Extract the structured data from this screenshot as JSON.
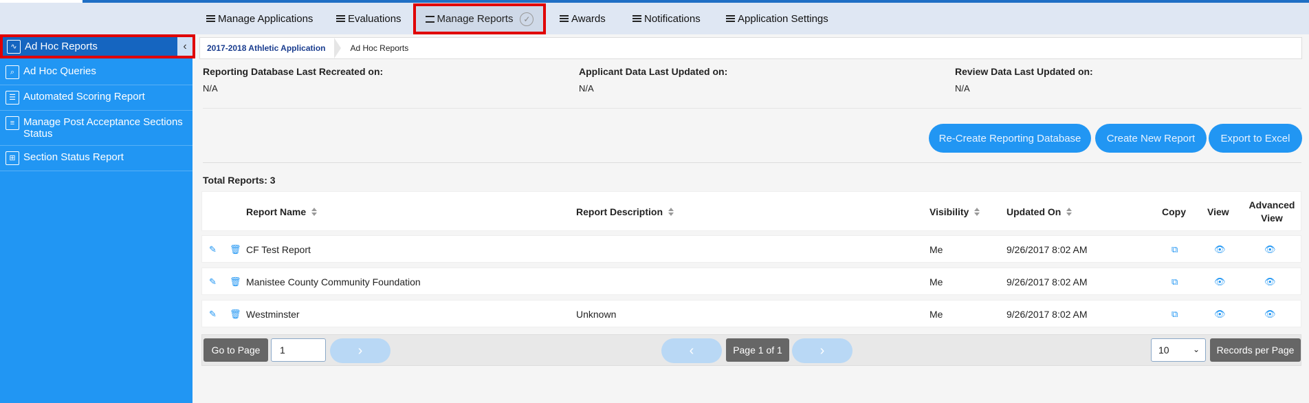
{
  "topnav": {
    "items": [
      {
        "label": "Manage Applications"
      },
      {
        "label": "Evaluations"
      },
      {
        "label": "Manage Reports"
      },
      {
        "label": "Awards"
      },
      {
        "label": "Notifications"
      },
      {
        "label": "Application Settings"
      }
    ]
  },
  "sidebar": {
    "items": [
      {
        "label": "Ad Hoc Reports"
      },
      {
        "label": "Ad Hoc Queries"
      },
      {
        "label": "Automated Scoring Report"
      },
      {
        "label": "Manage Post Acceptance Sections Status"
      },
      {
        "label": "Section Status Report"
      }
    ]
  },
  "breadcrumb": {
    "application": "2017-2018 Athletic Application",
    "current": "Ad Hoc Reports"
  },
  "info": {
    "db_label": "Reporting Database Last Recreated on:",
    "db_value": "N/A",
    "applicant_label": "Applicant Data Last Updated on:",
    "applicant_value": "N/A",
    "review_label": "Review Data Last Updated on:",
    "review_value": "N/A"
  },
  "actions": {
    "recreate": "Re-Create Reporting Database",
    "create": "Create New Report",
    "export": "Export to Excel"
  },
  "table": {
    "total_label": "Total Reports: 3",
    "headers": {
      "name": "Report Name",
      "description": "Report Description",
      "visibility": "Visibility",
      "updated": "Updated On",
      "copy": "Copy",
      "view": "View",
      "advanced": "Advanced View"
    },
    "rows": [
      {
        "name": "CF Test Report",
        "description": "",
        "visibility": "Me",
        "updated": "9/26/2017 8:02 AM"
      },
      {
        "name": "Manistee County Community Foundation",
        "description": "",
        "visibility": "Me",
        "updated": "9/26/2017 8:02 AM"
      },
      {
        "name": "Westminster",
        "description": "Unknown",
        "visibility": "Me",
        "updated": "9/26/2017 8:02 AM"
      }
    ]
  },
  "pager": {
    "goto_label": "Go to Page",
    "page_value": "1",
    "page_info": "Page 1 of 1",
    "per_page_value": "10",
    "per_page_label": "Records per Page"
  },
  "colors": {
    "accent": "#2196f3",
    "highlight": "#e00000"
  }
}
